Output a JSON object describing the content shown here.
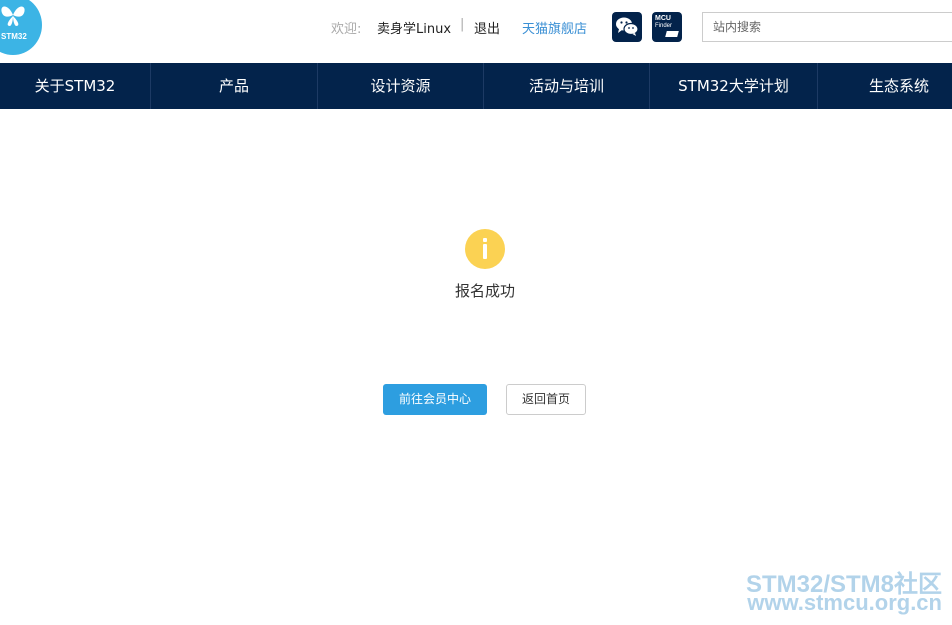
{
  "header": {
    "logo_text": "STM32",
    "welcome_label": "欢迎:",
    "username": "卖身学Linux",
    "separator": "|",
    "logout_label": "退出",
    "tmall_label": "天猫旗舰店",
    "mcu_finder": {
      "line1": "MCU",
      "line2": "Finder"
    },
    "search_placeholder": "站内搜索",
    "search_value": ""
  },
  "nav": {
    "items": [
      {
        "label": "关于STM32"
      },
      {
        "label": "产品"
      },
      {
        "label": "设计资源"
      },
      {
        "label": "活动与培训"
      },
      {
        "label": "STM32大学计划"
      },
      {
        "label": "生态系统"
      }
    ]
  },
  "main": {
    "message": "报名成功",
    "primary_button": "前往会员中心",
    "secondary_button": "返回首页"
  },
  "watermark": {
    "line1": "STM32/STM8社区",
    "line2": "www.stmcu.org.cn"
  },
  "colors": {
    "nav_bg": "#03234b",
    "brand_blue": "#3cb4e5",
    "link_blue": "#3a8fd4",
    "info_yellow": "#fbd253",
    "primary_button": "#2d9ee0"
  },
  "icons": [
    "stm32-logo-icon",
    "wechat-icon",
    "mcu-finder-icon",
    "info-icon"
  ]
}
